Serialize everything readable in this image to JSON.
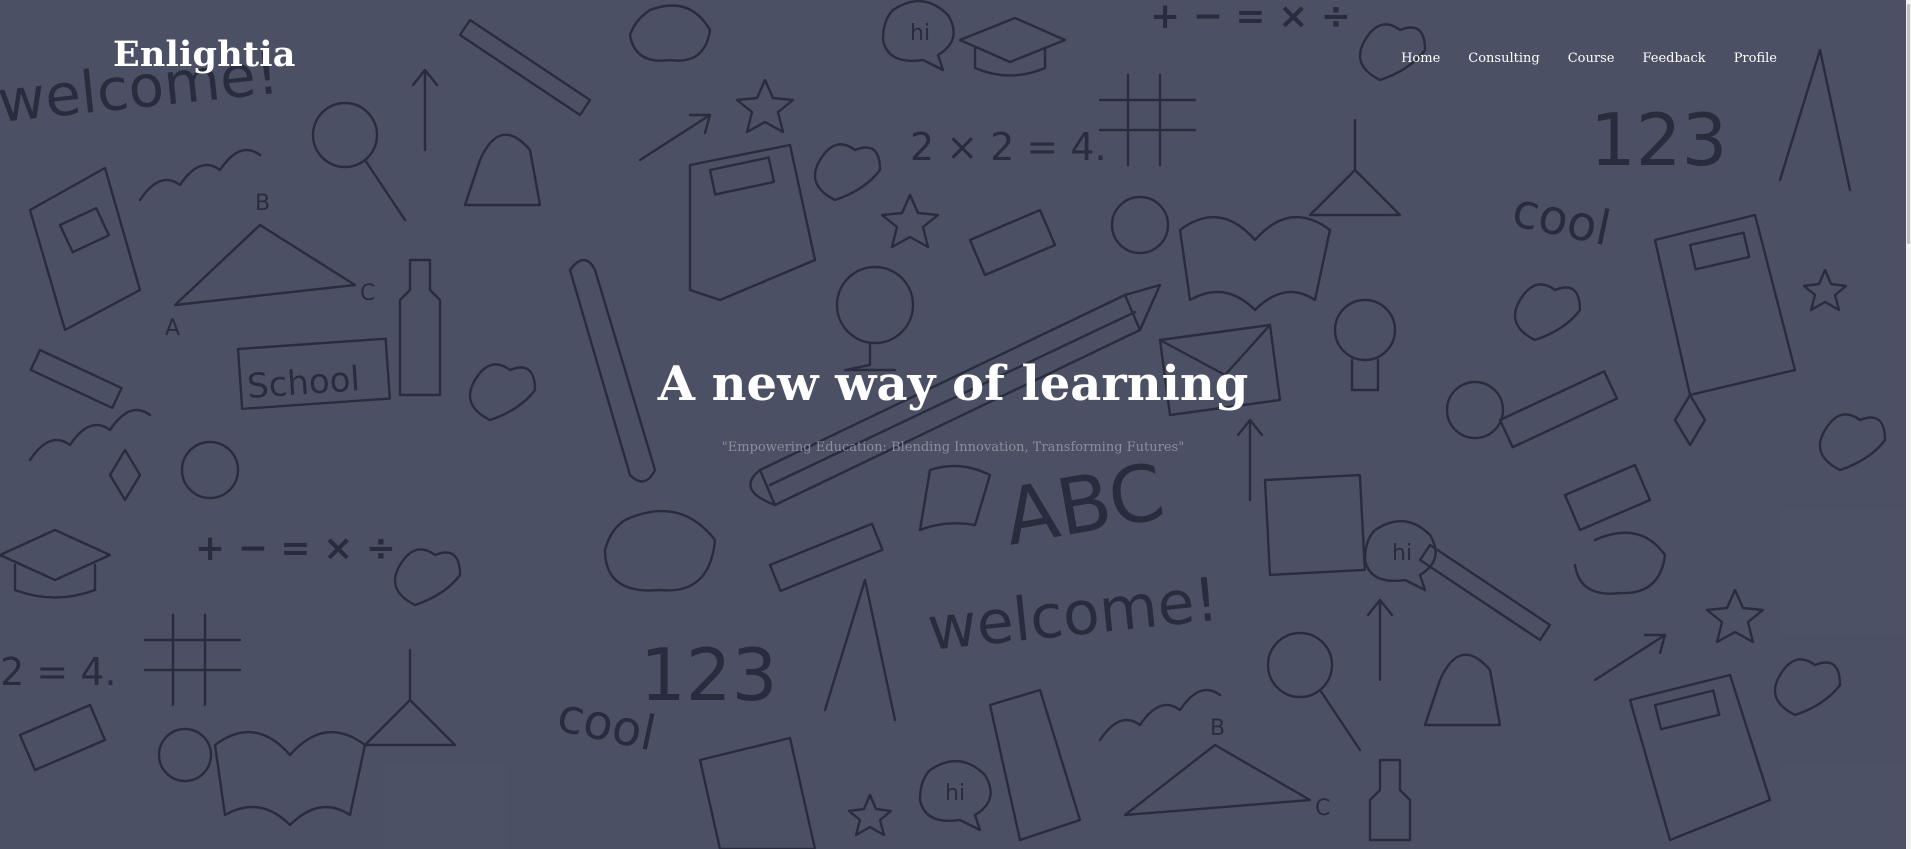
{
  "brand": {
    "name": "Enlightia"
  },
  "nav": {
    "items": [
      {
        "label": "Home"
      },
      {
        "label": "Consulting"
      },
      {
        "label": "Course"
      },
      {
        "label": "Feedback"
      },
      {
        "label": "Profile"
      }
    ]
  },
  "hero": {
    "title": "A new way of learning",
    "subtitle": "\"Empowering Education: Blending Innovation, Transforming Futures\""
  },
  "background": {
    "base_color": "#4c5165",
    "doodle_color": "#1d2030",
    "doodle_text": {
      "welcome": "welcome!",
      "school": "School",
      "cool": "cool",
      "numbers": "123",
      "abc": "ABC",
      "math_ops": "+ − = × ÷",
      "equation": "2 × 2 = 4.",
      "hi": "hi",
      "vertex_a": "A",
      "vertex_b": "B",
      "vertex_c": "C"
    }
  },
  "colors": {
    "nav_text": "#ffffff",
    "title_text": "#ffffff",
    "subtitle_text": "#8a8e9c"
  }
}
